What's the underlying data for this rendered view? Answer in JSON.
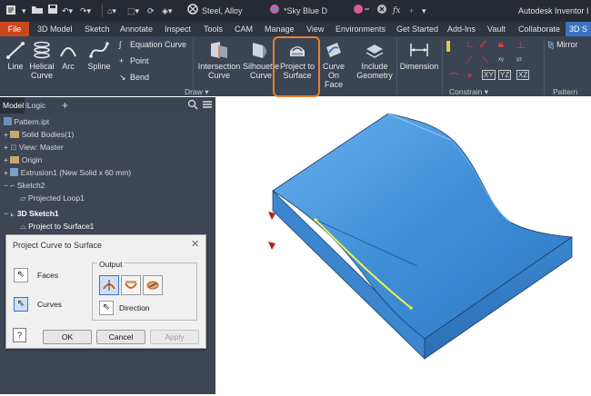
{
  "titlebar": {
    "material": "Steel, Alloy",
    "appearance": "*Sky Blue D",
    "app_title": "Autodesk Inventor I"
  },
  "menu_tabs": [
    "File",
    "3D Model",
    "Sketch",
    "Annotate",
    "Inspect",
    "Tools",
    "CAM",
    "Manage",
    "View",
    "Environments",
    "Get Started",
    "Add-Ins",
    "Vault",
    "Collaborate",
    "3D S"
  ],
  "ribbon": {
    "draw_tools": {
      "line": "Line",
      "helical_curve": [
        "Helical",
        "Curve"
      ],
      "arc": "Arc",
      "spline": "Spline",
      "equation_curve": "Equation Curve",
      "point": "Point",
      "bend": "Bend"
    },
    "draw_commands": {
      "intersection_curve": [
        "Intersection",
        "Curve"
      ],
      "silhouette_curve": [
        "Silhouette",
        "Curve"
      ],
      "project_to_surface": [
        "Project to",
        "Surface"
      ],
      "curve_on_face": [
        "Curve",
        "On Face"
      ],
      "include_geometry": [
        "Include",
        "Geometry"
      ]
    },
    "dimension": "Dimension",
    "mirror": "Mirror",
    "panel_labels": {
      "draw": "Draw",
      "constrain": "Constrain",
      "pattern": "Pattern"
    }
  },
  "browser": {
    "tabs": {
      "model": "Model",
      "logic": "iLogic"
    },
    "items": [
      "Pattern.ipt",
      "Solid Bodies(1)",
      "View: Master",
      "Origin",
      "Extrusion1 (New Solid x 60 mm)",
      "Sketch2",
      "Projected Loop1",
      "3D Sketch1",
      "Project to Surface1"
    ]
  },
  "dialog": {
    "title": "Project Curve to Surface",
    "faces_label": "Faces",
    "curves_label": "Curves",
    "output_label": "Output",
    "direction_label": "Direction",
    "help": "?",
    "ok": "OK",
    "cancel": "Cancel",
    "apply": "Apply"
  },
  "colors": {
    "file_tab": "#c9471c",
    "active_tab": "#3a73c0",
    "highlight": "#e8822c",
    "part_blue": "#3f8fd6",
    "projected_curve": "#f0f050"
  }
}
